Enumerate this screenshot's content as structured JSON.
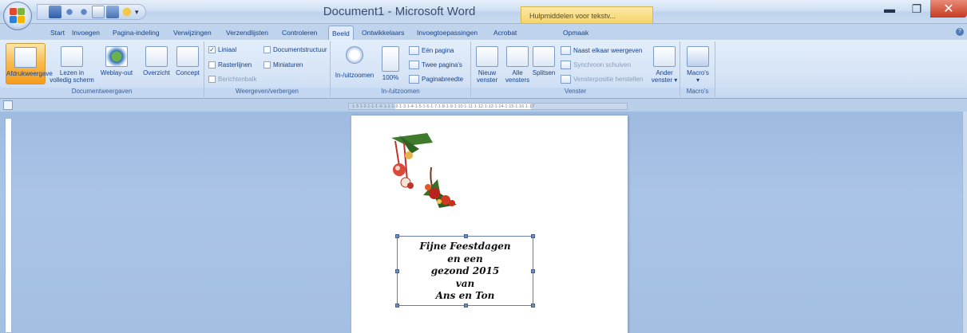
{
  "window": {
    "title": "Document1 - Microsoft Word",
    "contextual_tab": "Hulpmiddelen voor tekstv..."
  },
  "tabs": [
    "Start",
    "Invoegen",
    "Pagina-indeling",
    "Verwijzingen",
    "Verzendlijsten",
    "Controleren",
    "Beeld",
    "Ontwikkelaars",
    "Invoegtoepassingen",
    "Acrobat",
    "Opmaak"
  ],
  "active_tab": "Beeld",
  "ribbon": {
    "documentweergaven": {
      "label": "Documentweergaven",
      "afdrukweergave": "Afdrukweergave",
      "lezen_line1": "Lezen in",
      "lezen_line2": "volledig scherm",
      "weblay_out": "Weblay-out",
      "overzicht": "Overzicht",
      "concept": "Concept"
    },
    "weergeven": {
      "label": "Weergeven/verbergen",
      "liniaal": "Liniaal",
      "rasterlijnen": "Rasterlijnen",
      "berichtenbalk": "Berichtenbalk",
      "documentstructuur": "Documentstructuur",
      "miniaturen": "Miniaturen"
    },
    "zoom": {
      "label": "In-/uitzoomen",
      "in_uitzoomen": "In-/uitzoomen",
      "honderd": "100%",
      "een_pagina": "Eén pagina",
      "twee_paginas": "Twee pagina's",
      "paginabreedte": "Paginabreedte"
    },
    "venster": {
      "label": "Venster",
      "nieuw_line1": "Nieuw",
      "nieuw_line2": "venster",
      "alle_line1": "Alle",
      "alle_line2": "vensters",
      "splitsen": "Splitsen",
      "naast_elkaar": "Naast elkaar weergeven",
      "synchroon": "Synchroon schuiven",
      "vensterpositie": "Vensterpositie herstellen",
      "ander_line1": "Ander",
      "ander_line2": "venster ▾"
    },
    "macros": {
      "label": "Macro's",
      "macros_btn": "Macro's"
    }
  },
  "ruler_text": "·1·3·1·2·1·1·1·X·1·1·1·2·1·3·1·4·1·5·1·6·1·7·1·8·1·9·1·10·1·11·1·12·1·13·1·14·1·15·1·16·1·17",
  "document": {
    "lines": [
      "Fijne Feestdagen",
      "en een",
      "gezond 2015",
      "van",
      "Ans en Ton"
    ]
  },
  "colors": {
    "ribbon_bg": "#d3e2f5",
    "selected_button": "#f8b94a",
    "close_button": "#c7391f",
    "contextual_tab": "#f6d46b"
  }
}
